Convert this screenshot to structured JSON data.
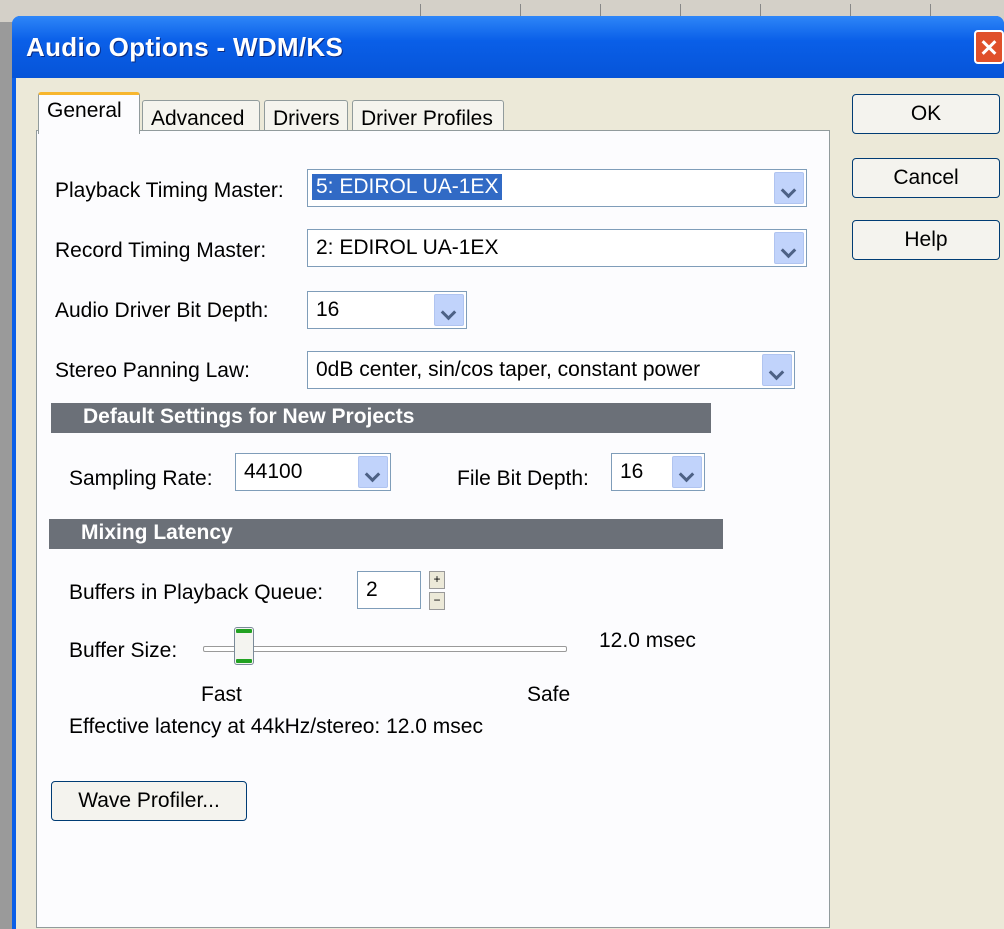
{
  "window": {
    "title": "Audio Options - WDM/KS"
  },
  "tabs": [
    "General",
    "Advanced",
    "Drivers",
    "Driver Profiles"
  ],
  "buttons": {
    "ok": "OK",
    "cancel": "Cancel",
    "help": "Help",
    "wave_profiler": "Wave Profiler..."
  },
  "general": {
    "playback_timing_master": {
      "label": "Playback Timing Master:",
      "value": "5: EDIROL UA-1EX"
    },
    "record_timing_master": {
      "label": "Record Timing Master:",
      "value": "2: EDIROL UA-1EX"
    },
    "audio_driver_bit_depth": {
      "label": "Audio Driver Bit Depth:",
      "value": "16"
    },
    "stereo_panning_law": {
      "label": "Stereo Panning Law:",
      "value": "0dB center, sin/cos taper, constant power"
    }
  },
  "defaults": {
    "heading": "Default Settings for New Projects",
    "sampling_rate": {
      "label": "Sampling Rate:",
      "value": "44100"
    },
    "file_bit_depth": {
      "label": "File Bit Depth:",
      "value": "16"
    }
  },
  "mixing": {
    "heading": "Mixing Latency",
    "buffers": {
      "label": "Buffers in Playback Queue:",
      "value": "2"
    },
    "buffer_size": {
      "label": "Buffer Size:",
      "value_text": "12.0 msec",
      "position": 0.09
    },
    "slider_min": "Fast",
    "slider_max": "Safe",
    "effective_latency": "Effective latency at 44kHz/stereo:  12.0 msec"
  }
}
